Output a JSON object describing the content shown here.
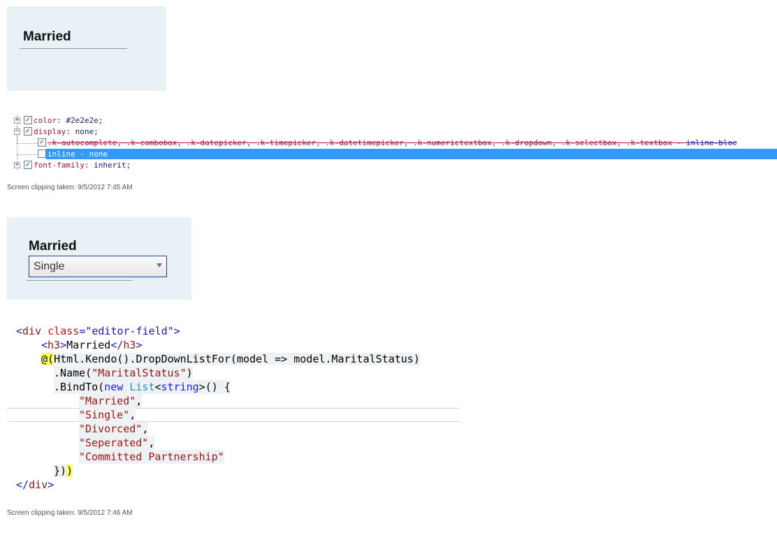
{
  "clip1": {
    "heading": "Married"
  },
  "css_inspector": {
    "rows": [
      {
        "prop": "color",
        "value": "#2e2e2e;"
      },
      {
        "prop": "display",
        "value": "none;"
      },
      {
        "struck_selectors": ".k-autocomplete, .k-combobox, .k-datepicker, .k-timepicker, .k-datetimepicker, .k-numerictextbox, .k-dropdown, .k-selectbox, .k-textbox",
        "struck_dash": " - ",
        "struck_value": "inline-bloc"
      },
      {
        "selected": "inline - none"
      },
      {
        "prop": "font-family",
        "value": "inherit;"
      }
    ]
  },
  "caption1": "Screen clipping taken: 9/5/2012 7:45 AM",
  "clip2": {
    "heading": "Married",
    "dropdown_value": "Single"
  },
  "code": {
    "l1_open": "<",
    "l1_tag": "div",
    "l1_attr": " class",
    "l1_eq": "=",
    "l1_val": "\"editor-field\"",
    "l1_close": ">",
    "l2_open": "<",
    "l2_tag": "h3",
    "l2_close": ">",
    "l2_text": "Married",
    "l2_end_open": "</",
    "l2_end_tag": "h3",
    "l2_end_close": ">",
    "l3_razor": "@(",
    "l3_text": "Html.Kendo().DropDownListFor(model => model.MaritalStatus)",
    "l4_text": ".Name(",
    "l4_str": "\"MaritalStatus\"",
    "l4_end": ")",
    "l5_text1": ".BindTo(",
    "l5_kw": "new",
    "l5_type": "List",
    "l5_lt": "<",
    "l5_kw2": "string",
    "l5_gt": ">",
    "l5_text2": "() {",
    "items": [
      "\"Married\"",
      "\"Single\"",
      "\"Divorced\"",
      "\"Seperated\"",
      "\"Committed Partnership\""
    ],
    "comma": ",",
    "l11_text": "})",
    "l11_razor": ")",
    "l12_open": "</",
    "l12_tag": "div",
    "l12_close": ">"
  },
  "caption2": "Screen clipping taken: 9/5/2012 7:46 AM",
  "colors": {
    "panel_bg": "#e8f1f6",
    "selection": "#3399ff",
    "dropdown_border": "#1f3ca8",
    "razor_highlight": "#ffff66"
  }
}
